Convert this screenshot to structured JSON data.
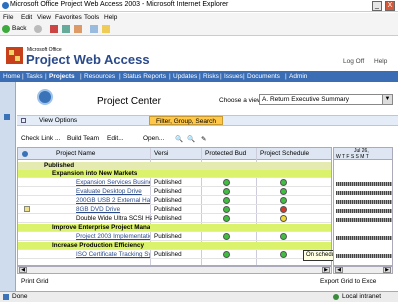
{
  "window": {
    "title": "Microsoft Office Project Web Access 2003 - Microsoft Internet Explorer",
    "minimize": "_",
    "close": "X"
  },
  "menu": [
    "File",
    "Edit",
    "View",
    "Favorites",
    "Tools",
    "Help"
  ],
  "toolbar": {
    "back_label": "Back"
  },
  "header": {
    "brand_small": "Microsoft Office",
    "brand_big": "Project Web Access",
    "logoff": "Log Off",
    "help": "Help"
  },
  "nav": [
    "Home",
    "Tasks",
    "Projects",
    "Resources",
    "Status Reports",
    "Updates",
    "Risks",
    "Issues",
    "Documents",
    "Admin"
  ],
  "nav_separator": "|",
  "page": {
    "title": "Project Center",
    "view_label": "Choose a view:",
    "view_value": "A. Return Executive Summary"
  },
  "options": {
    "view_options": "View Options",
    "filter_group": "Filter, Group, Search"
  },
  "actions": [
    "Check Link ...",
    "Build Team",
    "Edit...",
    "Open..."
  ],
  "grid": {
    "headers": {
      "name": "Project Name",
      "version": "Versi",
      "protected": "Protected Bud",
      "schedule": "Project Schedule"
    },
    "groups": [
      {
        "label": "Published",
        "level": 0
      },
      {
        "label": "Expansion into New Markets",
        "level": 1
      },
      {
        "label": "Improve Enterprise Project Mana",
        "level": 1
      },
      {
        "label": "Increase Production Efficiency",
        "level": 1
      }
    ],
    "rows": [
      {
        "name": "Expansion Services Business",
        "version": "Published",
        "budget": "green",
        "schedule": "green"
      },
      {
        "name": "Evaluate Desktop Drive",
        "version": "Published",
        "budget": "green",
        "schedule": "green"
      },
      {
        "name": "200GB USB 2 External Hard Drive",
        "version": "Published",
        "budget": "green",
        "schedule": "green"
      },
      {
        "name": "8GB DVD Drive",
        "version": "Published",
        "budget": "green",
        "schedule": "red"
      },
      {
        "name": "Double Wide Ultra SCSI Hard Drive",
        "version": "Published",
        "budget": "green",
        "schedule": "yellow"
      },
      {
        "name": "Project 2003 Implementation",
        "version": "Published",
        "budget": "green",
        "schedule": "green"
      },
      {
        "name": "ISO Certificate Tracking System",
        "version": "Published",
        "budget": "green",
        "schedule": "green"
      }
    ],
    "tooltip": "On schedule"
  },
  "gantt": {
    "header_top": "Jul 26, ",
    "days": "W T F S S M T"
  },
  "footer": {
    "print_grid": "Print Grid",
    "export": "Export Grid to Exce"
  },
  "status": {
    "left": "Done",
    "right": "Local intranet"
  },
  "colors": {
    "nav_bg": "#3b6db5",
    "group_bg": "#d9e85a",
    "green": "#3fbf3f",
    "red": "#d43a2a",
    "yellow": "#f0d836"
  }
}
